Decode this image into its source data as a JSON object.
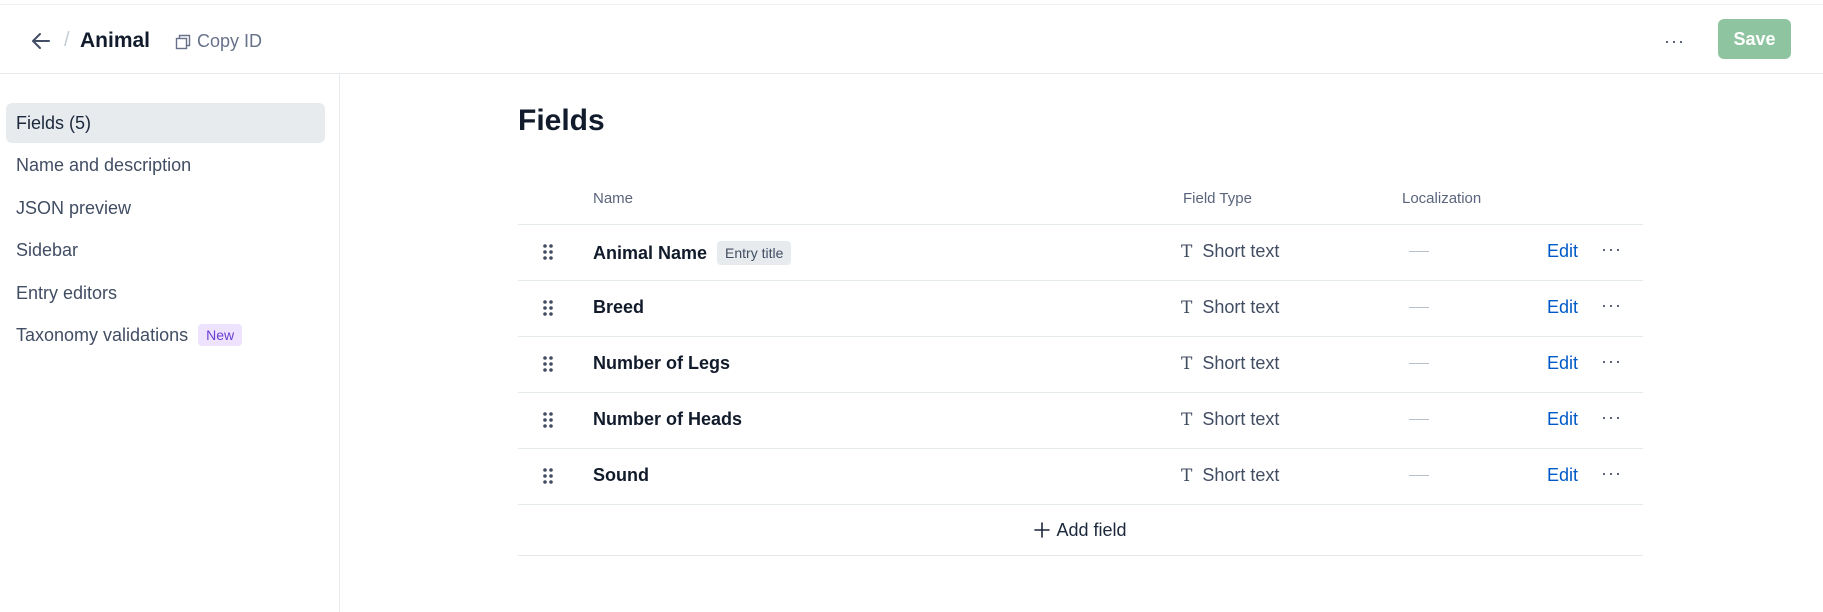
{
  "header": {
    "title": "Animal",
    "copy_id_label": "Copy ID",
    "more_label": "···",
    "save_label": "Save"
  },
  "sidebar": {
    "items": [
      {
        "label": "Fields (5)",
        "active": true
      },
      {
        "label": "Name and description"
      },
      {
        "label": "JSON preview"
      },
      {
        "label": "Sidebar"
      },
      {
        "label": "Entry editors"
      },
      {
        "label": "Taxonomy validations",
        "badge": "New"
      }
    ]
  },
  "main": {
    "title": "Fields",
    "columns": {
      "name": "Name",
      "field_type": "Field Type",
      "localization": "Localization"
    },
    "fields": [
      {
        "name": "Animal Name",
        "tag": "Entry title",
        "type_icon": "T",
        "type": "Short text",
        "edit": "Edit",
        "more": "···"
      },
      {
        "name": "Breed",
        "type_icon": "T",
        "type": "Short text",
        "edit": "Edit",
        "more": "···"
      },
      {
        "name": "Number of Legs",
        "type_icon": "T",
        "type": "Short text",
        "edit": "Edit",
        "more": "···"
      },
      {
        "name": "Number of Heads",
        "type_icon": "T",
        "type": "Short text",
        "edit": "Edit",
        "more": "···"
      },
      {
        "name": "Sound",
        "type_icon": "T",
        "type": "Short text",
        "edit": "Edit",
        "more": "···"
      }
    ],
    "add_field_label": "Add field"
  }
}
